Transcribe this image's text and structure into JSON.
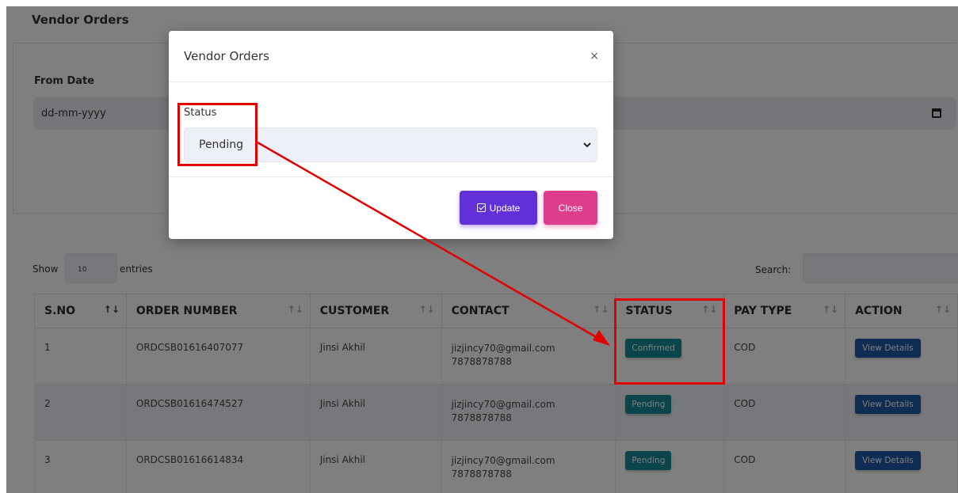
{
  "page": {
    "title": "Vendor Orders",
    "from_date_label": "From Date",
    "from_date_placeholder": "dd-mm-yyyy",
    "show_label": "Show",
    "page_length": "10",
    "entries_label": "entries",
    "search_label": "Search:"
  },
  "table": {
    "columns": [
      "S.NO",
      "ORDER NUMBER",
      "CUSTOMER",
      "CONTACT",
      "STATUS",
      "PAY TYPE",
      "ACTION"
    ],
    "rows": [
      {
        "sno": "1",
        "order": "ORDCSB01616407077",
        "customer": "Jinsi Akhil",
        "email": "jizjincy70@gmail.com",
        "phone": "7878878788",
        "status": "Confirmed",
        "pay": "COD",
        "action": "View Details"
      },
      {
        "sno": "2",
        "order": "ORDCSB01616474527",
        "customer": "Jinsi Akhil",
        "email": "jizjincy70@gmail.com",
        "phone": "7878878788",
        "status": "Pending",
        "pay": "COD",
        "action": "View Details"
      },
      {
        "sno": "3",
        "order": "ORDCSB01616614834",
        "customer": "Jinsi Akhil",
        "email": "jizjincy70@gmail.com",
        "phone": "7878878788",
        "status": "Pending",
        "pay": "COD",
        "action": "View Details"
      }
    ]
  },
  "modal": {
    "title": "Vendor Orders",
    "close_glyph": "×",
    "status_label": "Status",
    "status_value": "Pending",
    "update_label": "Update",
    "close_label": "Close"
  },
  "colors": {
    "badge": "#138b95",
    "view_button": "#1e5aa6",
    "update_button": "#6230d8",
    "close_button": "#dd3d8a",
    "annotation": "#e00000"
  }
}
